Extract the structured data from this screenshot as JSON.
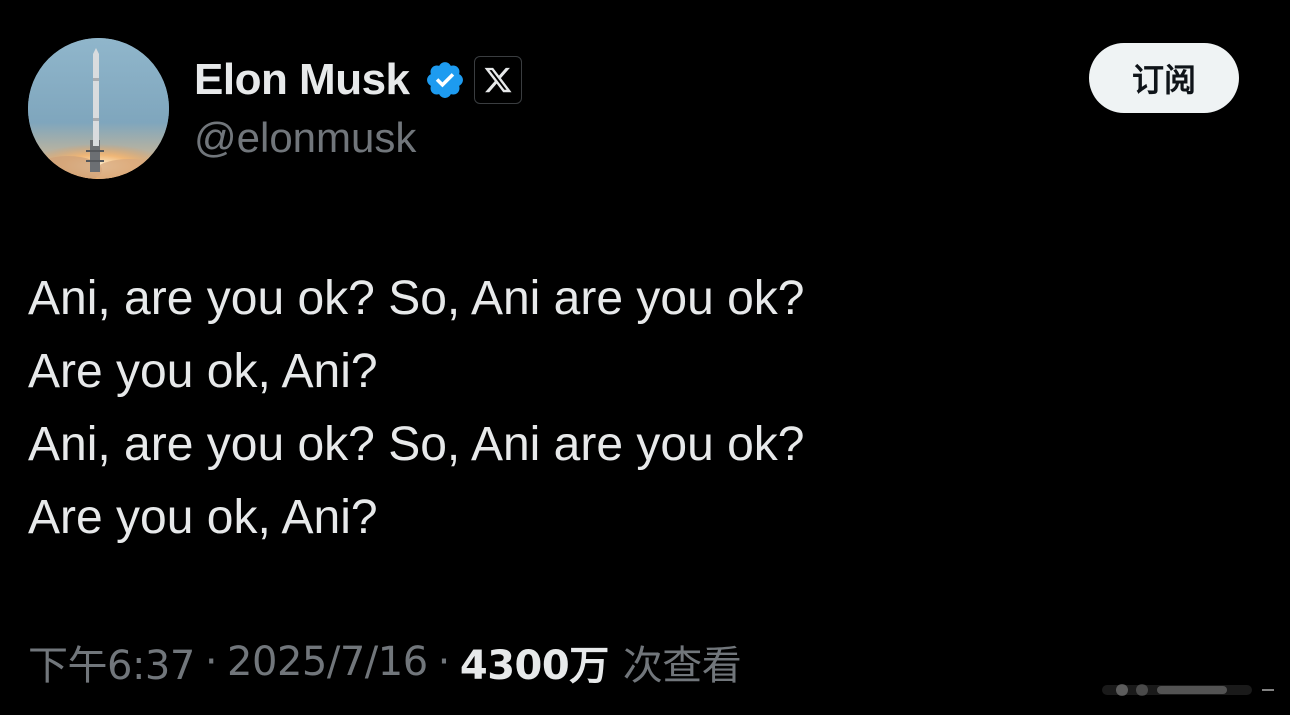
{
  "author": {
    "display_name": "Elon Musk",
    "handle": "@elonmusk",
    "verified_icon": "verified-badge-icon",
    "affiliate_icon": "x-logo-icon",
    "avatar_icon": "rocket-launch-avatar"
  },
  "subscribe_button": {
    "label": "订阅"
  },
  "tweet": {
    "lines": [
      "Ani, are you ok? So, Ani are you ok?",
      "Are you ok, Ani?",
      "Ani, are you ok? So, Ani are you ok?",
      "Are you ok, Ani?"
    ]
  },
  "meta": {
    "time": "下午6:37",
    "separator": "·",
    "date": "2025/7/16",
    "views_count": "4300万",
    "views_label": "次查看"
  },
  "colors": {
    "background": "#000000",
    "primary_text": "#e7e9ea",
    "secondary_text": "#71767b",
    "verified_blue": "#1d9bf0",
    "button_bg": "#eff3f4"
  }
}
